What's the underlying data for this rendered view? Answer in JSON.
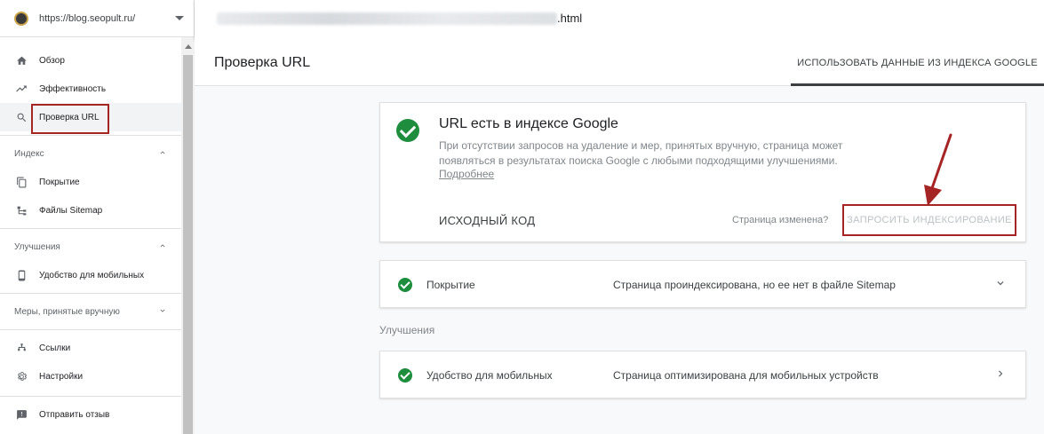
{
  "property": {
    "url": "https://blog.seopult.ru/"
  },
  "topbar": {
    "url_suffix": ".html"
  },
  "sidebar": {
    "items_top": [
      {
        "label": "Обзор",
        "icon": "home-icon"
      },
      {
        "label": "Эффективность",
        "icon": "trending-up-icon"
      },
      {
        "label": "Проверка URL",
        "icon": "search-icon",
        "active": true
      }
    ],
    "section_index": {
      "label": "Индекс",
      "items": [
        {
          "label": "Покрытие",
          "icon": "copy-icon"
        },
        {
          "label": "Файлы Sitemap",
          "icon": "sitemap-icon"
        }
      ]
    },
    "section_enh": {
      "label": "Улучшения",
      "items": [
        {
          "label": "Удобство для мобильных",
          "icon": "phone-icon"
        }
      ]
    },
    "section_manual": {
      "label": "Меры, принятые вручную"
    },
    "items_bottom": [
      {
        "label": "Ссылки",
        "icon": "links-icon"
      },
      {
        "label": "Настройки",
        "icon": "gear-icon"
      },
      {
        "label": "Отправить отзыв",
        "icon": "feedback-icon"
      }
    ]
  },
  "header": {
    "title": "Проверка URL",
    "tab": "ИСПОЛЬЗОВАТЬ ДАННЫЕ ИЗ ИНДЕКСА GOOGLE"
  },
  "status_card": {
    "title": "URL есть в индексе Google",
    "description": "При отсутствии запросов на удаление и мер, принятых вручную, страница может появляться в результатах поиска Google с любыми подходящими улучшениями.",
    "link": "Подробнее",
    "source_button": "ИСХОДНЫЙ КОД",
    "changed_label": "Страница изменена?",
    "request_button": "ЗАПРОСИТЬ ИНДЕКСИРОВАНИЕ"
  },
  "coverage": {
    "label": "Покрытие",
    "value": "Страница проиндексирована, но ее нет в файле Sitemap"
  },
  "enhancements_label": "Улучшения",
  "mobile": {
    "label": "Удобство для мобильных",
    "value": "Страница оптимизирована для мобильных устройств"
  },
  "colors": {
    "accent_green": "#1e8e3e",
    "highlight_red": "#a52525"
  }
}
